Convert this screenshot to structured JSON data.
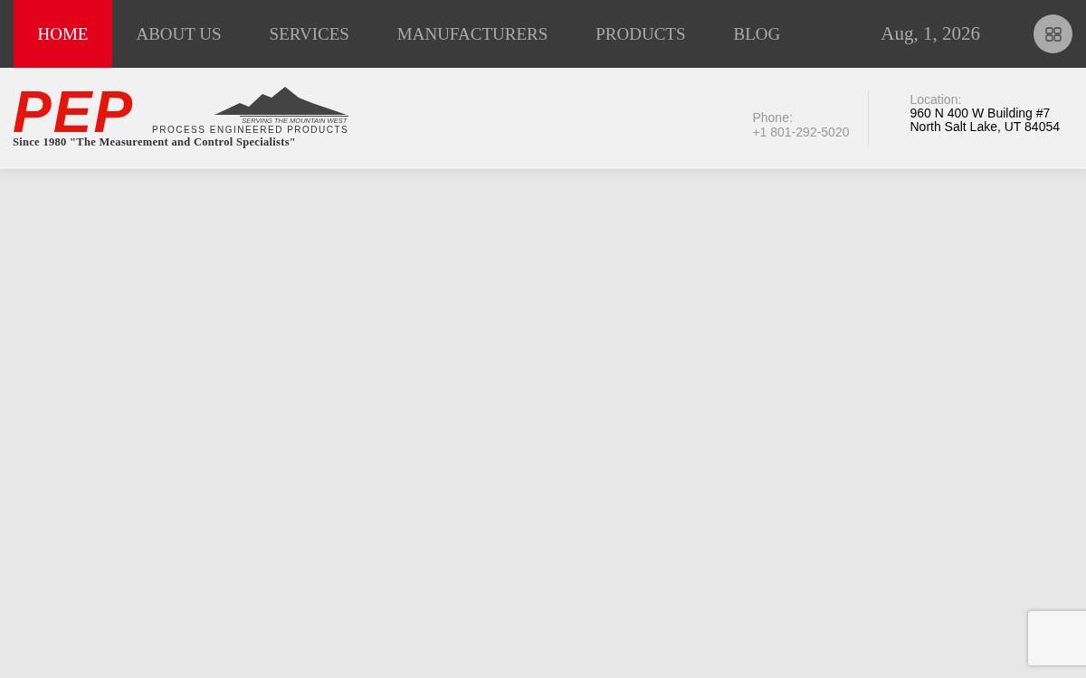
{
  "nav": {
    "items": [
      {
        "label": "HOME",
        "selected": true
      },
      {
        "label": "ABOUT US",
        "selected": false
      },
      {
        "label": "SERVICES",
        "selected": false
      },
      {
        "label": "MANUFACTURERS",
        "selected": false
      },
      {
        "label": "PRODUCTS",
        "selected": false
      },
      {
        "label": "BLOG",
        "selected": false
      }
    ],
    "date": "Aug, 1, 2026"
  },
  "logo": {
    "mark": "PEP",
    "slogan": "SERVING THE MOUNTAIN WEST",
    "company": "PROCESS ENGINEERED PRODUCTS",
    "tagline": "Since 1980 \"The Measurement and Control Specialists\""
  },
  "contact": {
    "phone_label": "Phone:",
    "phone": "+1 801-292-5020",
    "location_label": "Location:",
    "address_lines": [
      "960 N 400 W Building #7",
      "North Salt Lake, UT 84054"
    ]
  }
}
